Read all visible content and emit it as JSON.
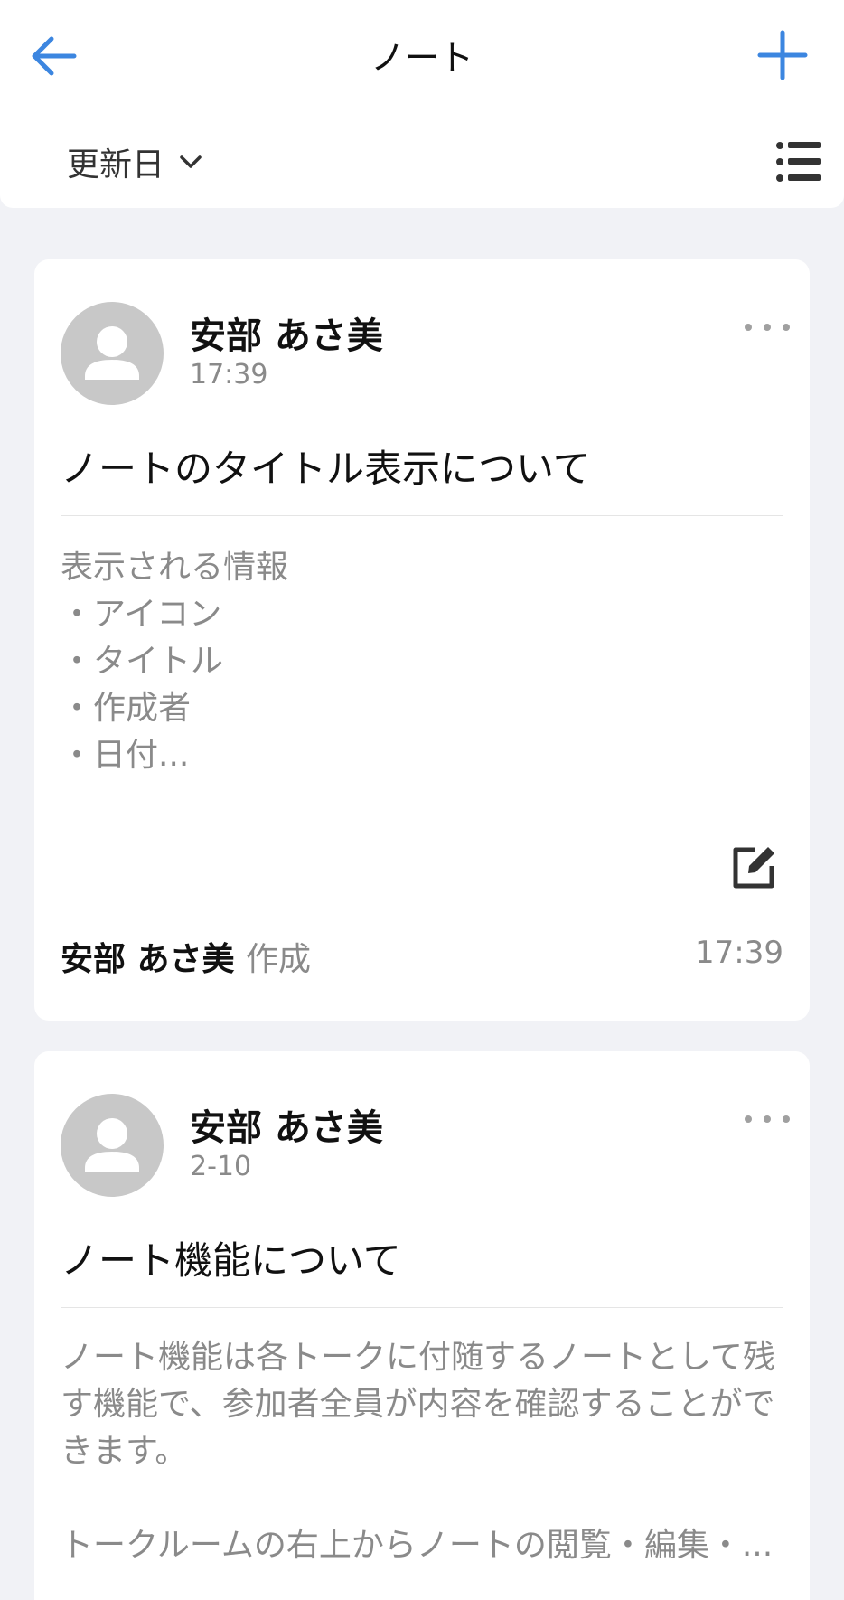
{
  "header": {
    "title": "ノート"
  },
  "sortbar": {
    "sort_label": "更新日"
  },
  "notes": [
    {
      "author": "安部 あさ美",
      "time": "17:39",
      "title": "ノートのタイトル表示について",
      "body_lines": [
        "表示される情報",
        "・アイコン",
        "・タイトル",
        "・作成者",
        "・日付..."
      ],
      "footer_author": "安部 あさ美",
      "footer_action": "作成",
      "footer_time": "17:39"
    },
    {
      "author": "安部 あさ美",
      "time": "2-10",
      "title": "ノート機能について",
      "body_paragraph_1": "ノート機能は各トークに付随するノートとして残す機能で、参加者全員が内容を確認することができます。",
      "body_paragraph_2": "トークルームの右上からノートの閲覧・編集・..."
    }
  ],
  "colors": {
    "accent": "#3c86e0",
    "background": "#f1f2f6",
    "muted_text": "#8a8a8a",
    "avatar": "#c8c8c8"
  },
  "icons": {
    "back": "arrow-left-icon",
    "add": "plus-icon",
    "sort": "chevron-down-icon",
    "view": "list-icon",
    "more": "ellipsis-icon",
    "edit": "edit-icon",
    "avatar": "person-icon"
  }
}
